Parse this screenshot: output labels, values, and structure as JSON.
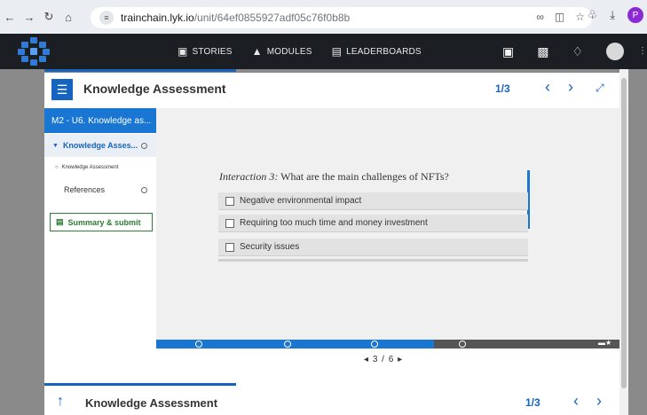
{
  "browser": {
    "url_host": "trainchain.lyk.io",
    "url_path": "/unit/64ef0855927adf05c76f0b8b",
    "profile_initial": "P"
  },
  "header": {
    "nav": [
      {
        "label": "STORIES",
        "icon": "camera-icon"
      },
      {
        "label": "MODULES",
        "icon": "graduation-cap-icon"
      },
      {
        "label": "LEADERBOARDS",
        "icon": "leaderboard-icon"
      }
    ]
  },
  "card": {
    "title": "Knowledge Assessment",
    "page": "1/3"
  },
  "sidebar": {
    "unit_title": "M2 - U6. Knowledge as...",
    "section_label": "Knowledge Asses...",
    "sub_item": "Knowledge Assessment",
    "references": "References",
    "summary_button": "Summary & submit"
  },
  "question": {
    "label": "Interaction 3:",
    "text": "What are the main challenges of NFTs?",
    "options": [
      "Negative environmental impact",
      "Requiring too much time and money investment",
      "Security issues"
    ]
  },
  "progress": {
    "filled_fraction": 0.6,
    "pager": "3 / 6"
  },
  "bottom": {
    "title": "Knowledge Assessment",
    "page": "1/3"
  },
  "colors": {
    "accent": "#1565c0",
    "header_bg": "#1b1f24",
    "summary_green": "#2e7d32"
  }
}
